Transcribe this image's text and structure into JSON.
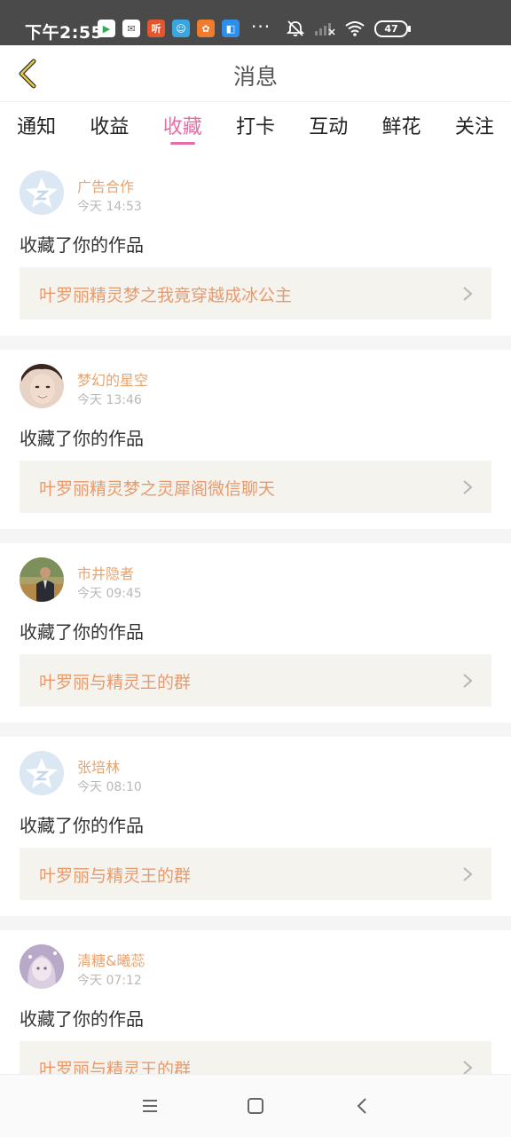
{
  "status_bar": {
    "time": "下午2:55",
    "app_icons": [
      {
        "name": "play-store-icon",
        "glyph": "▶",
        "color": "#ffffff"
      },
      {
        "name": "mail-icon",
        "glyph": "✉",
        "color": "#ffffff"
      },
      {
        "name": "listen-app-icon",
        "glyph": "听",
        "color": "#e4572e"
      },
      {
        "name": "bilibili-icon",
        "glyph": "☺",
        "color": "#3aa6e0"
      },
      {
        "name": "game-app-icon",
        "glyph": "✿",
        "color": "#f07b2b"
      },
      {
        "name": "blue-app-icon",
        "glyph": "◧",
        "color": "#2f8fe8"
      }
    ],
    "more": "···",
    "battery": "47"
  },
  "header": {
    "title": "消息",
    "back_color": "#d4b12f"
  },
  "tabs": [
    {
      "label": "通知",
      "active": false
    },
    {
      "label": "收益",
      "active": false
    },
    {
      "label": "收藏",
      "active": true
    },
    {
      "label": "打卡",
      "active": false
    },
    {
      "label": "互动",
      "active": false
    },
    {
      "label": "鲜花",
      "active": false
    },
    {
      "label": "关注",
      "active": false
    }
  ],
  "accent_color": "#e36fa5",
  "messages": [
    {
      "user": "广告合作",
      "time": "今天 14:53",
      "action": "收藏了你的作品",
      "work": "叶罗丽精灵梦之我竟穿越成冰公主",
      "avatar": "default-avatar"
    },
    {
      "user": "梦幻的星空",
      "time": "今天 13:46",
      "action": "收藏了你的作品",
      "work": "叶罗丽精灵梦之灵犀阁微信聊天",
      "avatar": "photo-avatar-face"
    },
    {
      "user": "市井隐者",
      "time": "今天 09:45",
      "action": "收藏了你的作品",
      "work": "叶罗丽与精灵王的群",
      "avatar": "photo-avatar-man"
    },
    {
      "user": "张培林",
      "time": "今天 08:10",
      "action": "收藏了你的作品",
      "work": "叶罗丽与精灵王的群",
      "avatar": "default-avatar"
    },
    {
      "user": "清糖&曦蕊",
      "time": "今天 07:12",
      "action": "收藏了你的作品",
      "work": "叶罗丽与精灵王的群",
      "avatar": "photo-avatar-anime"
    }
  ]
}
